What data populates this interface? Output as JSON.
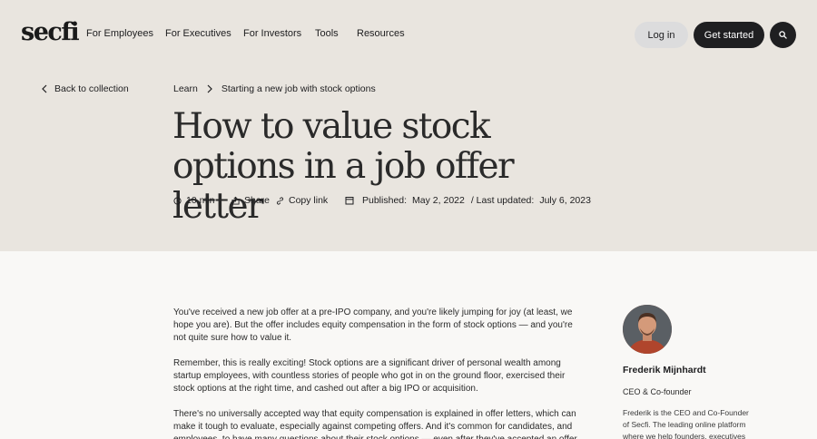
{
  "header": {
    "logo": "secfi",
    "nav": [
      "For Employees",
      "For Executives",
      "For Investors",
      "Tools",
      "Resources"
    ],
    "login_label": "Log in",
    "get_started_label": "Get started"
  },
  "back_label": "Back to collection",
  "breadcrumb": {
    "root": "Learn",
    "current": "Starting a new job with stock options"
  },
  "title": "How to value stock options in a job offer letter",
  "meta": {
    "read_time": "10 min",
    "share": "Share",
    "copy_link": "Copy link",
    "published_label": "Published:",
    "published_date": "May 2, 2022",
    "updated_label": "/ Last updated:",
    "updated_date": "July 6, 2023"
  },
  "article": {
    "paragraphs": [
      "You've received a new job offer at a pre-IPO company, and you're likely jumping for joy (at least, we hope you are). But the offer includes equity compensation in the form of stock options — and you're not quite sure how to value it.",
      "Remember, this is really exciting! Stock options are a significant driver of personal wealth among startup employees, with countless stories of people who got in on the ground floor, exercised their stock options at the right time, and cashed out after a big IPO or acquisition.",
      "There's no universally accepted way that equity compensation is explained in offer letters, which can make it tough to evaluate, especially against competing offers. And it's common for candidates, and employees, to have many questions about their stock options — even after they've accepted an offer."
    ]
  },
  "author": {
    "name": "Frederik Mijnhardt",
    "role": "CEO & Co-founder",
    "bio": "Frederik is the CEO and Co-Founder of Secfi. The leading online platform where we help founders, executives"
  }
}
